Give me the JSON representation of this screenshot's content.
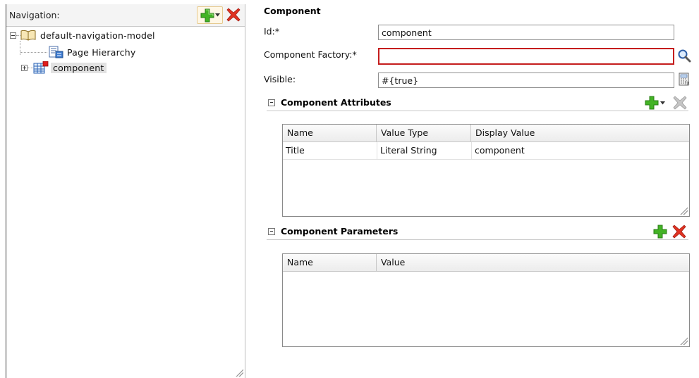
{
  "navigation": {
    "title": "Navigation:",
    "tree": [
      {
        "label": "default-navigation-model",
        "icon": "book-icon",
        "expanded": true
      },
      {
        "label": "Page Hierarchy",
        "icon": "page-hierarchy-icon"
      },
      {
        "label": "component",
        "icon": "component-grid-icon",
        "expanded": false,
        "selected": true
      }
    ]
  },
  "component": {
    "heading": "Component",
    "id_label": "Id:*",
    "id_value": "component",
    "factory_label": "Component Factory:*",
    "factory_value": "",
    "visible_label": "Visible:",
    "visible_value": "#{true}"
  },
  "attributes": {
    "title": "Component Attributes",
    "columns": [
      "Name",
      "Value Type",
      "Display Value"
    ],
    "rows": [
      {
        "name": "Title",
        "value_type": "Literal String",
        "display_value": "component"
      }
    ]
  },
  "parameters": {
    "title": "Component Parameters",
    "columns": [
      "Name",
      "Value"
    ],
    "rows": []
  },
  "colors": {
    "add_green": "#3fae1f",
    "delete_red": "#d9261c",
    "error_border": "#c51d1d"
  }
}
